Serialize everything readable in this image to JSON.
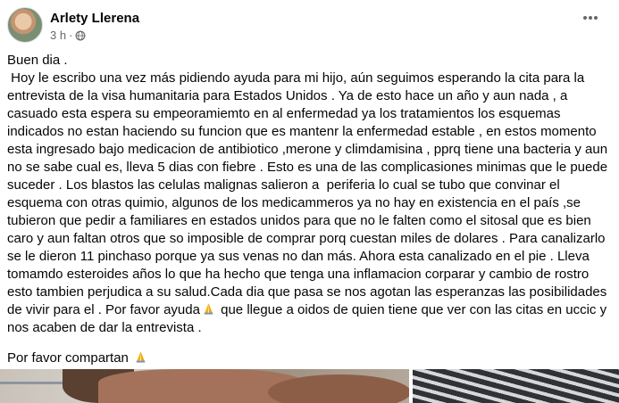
{
  "author": {
    "name": "Arlety Llerena"
  },
  "meta": {
    "time": "3 h",
    "separator": "·",
    "privacy_icon": "globe-icon"
  },
  "more_icon": "more-horizontal-icon",
  "post": {
    "greeting": "Buen dia .",
    "body": " Hoy le escribo una vez más pidiendo ayuda para mi hijo, aún seguimos esperando la cita para la entrevista de la visa humanitaria para Estados Unidos . Ya de esto hace un año y aun nada , a casuado esta espera su empeoramiemto en al enfermedad ya los tratamientos los esquemas indicados no estan haciendo su funcion que es mantenr la enfermedad estable , en estos momento esta ingresado bajo medicacion de antibiotico ,merone y climdamisina , pprq tiene una bacteria y aun no se sabe cual es, lleva 5 dias con fiebre . Esto es una de las complicasiones minimas que le puede suceder . Los blastos las celulas malignas salieron a  periferia lo cual se tubo que convinar el esquema con otras quimio, algunos de los medicammeros ya no hay en existencia en el país ,se tubieron que pedir a familiares en estados unidos para que no le falten como el sitosal que es bien caro y aun faltan otros que so imposible de comprar porq cuestan miles de dolares . Para canalizarlo se le dieron 11 pinchaso porque ya sus venas no dan más. Ahora esta canalizado en el pie . Lleva tomamdo esteroides años lo que ha hecho que tenga una inflamacion corparar y cambio de rostro esto tambien perjudica a su salud.Cada dia que pasa se nos agotan las esperanzas las posibilidades de vivir para el . Por favor ayuda",
    "body_after_emoji": " que llegue a oidos de quien tiene que ver con las citas en uccic y nos acaben de dar la entrevista .",
    "closing": "Por favor compartan",
    "emoji": "folded-hands-emoji"
  },
  "photos": {
    "count": 2
  }
}
